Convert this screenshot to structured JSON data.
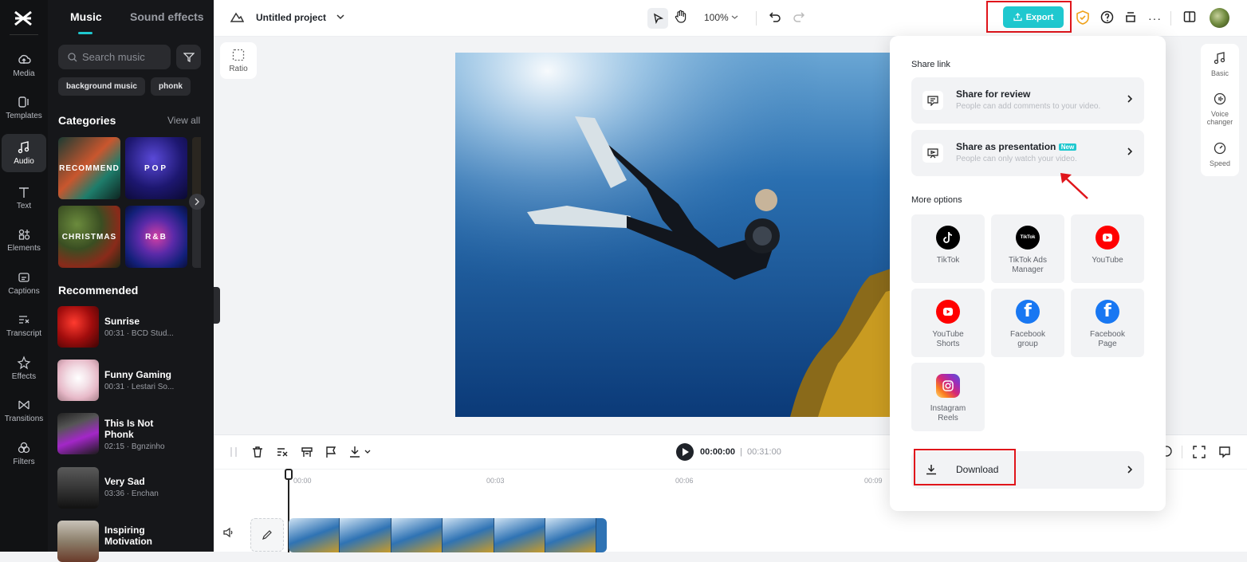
{
  "rail": {
    "items": [
      {
        "label": "Media",
        "icon": "cloud-icon"
      },
      {
        "label": "Templates",
        "icon": "templates-icon"
      },
      {
        "label": "Audio",
        "icon": "music-note-icon",
        "active": true
      },
      {
        "label": "Text",
        "icon": "text-icon"
      },
      {
        "label": "Elements",
        "icon": "elements-icon"
      },
      {
        "label": "Captions",
        "icon": "captions-icon"
      },
      {
        "label": "Transcript",
        "icon": "transcript-icon"
      },
      {
        "label": "Effects",
        "icon": "effects-icon"
      },
      {
        "label": "Transitions",
        "icon": "transitions-icon"
      },
      {
        "label": "Filters",
        "icon": "filters-icon"
      }
    ]
  },
  "panel": {
    "tabs": [
      "Music",
      "Sound effects"
    ],
    "search_placeholder": "Search music",
    "chips": [
      "background music",
      "phonk"
    ],
    "categories_title": "Categories",
    "view_all": "View all",
    "categories": [
      "RECOMMEND",
      "POP",
      "CHRISTMAS",
      "R&B"
    ],
    "recommended_title": "Recommended",
    "tracks": [
      {
        "name": "Sunrise",
        "meta": "00:31 · BCD Stud..."
      },
      {
        "name": "Funny Gaming",
        "meta": "00:31 · Lestari So..."
      },
      {
        "name": "This Is Not Phonk",
        "meta": "02:15 · Bgnzinho"
      },
      {
        "name": "Very Sad",
        "meta": "03:36 · Enchan"
      },
      {
        "name": "Inspiring Motivation",
        "meta": ""
      }
    ]
  },
  "topbar": {
    "project_name": "Untitled project",
    "zoom": "100%",
    "export_label": "Export"
  },
  "canvas": {
    "ratio_label": "Ratio"
  },
  "sidetools": [
    "Basic",
    "Voice changer",
    "Speed"
  ],
  "timeline": {
    "current_time": "00:00:00",
    "separator": "|",
    "total_time": "00:31:00",
    "ticks": [
      "00:00",
      "00:03",
      "00:06",
      "00:09"
    ]
  },
  "export_menu": {
    "share_link_title": "Share link",
    "share_review": {
      "title": "Share for review",
      "subtitle": "People can add comments to your video."
    },
    "share_presentation": {
      "title": "Share as presentation",
      "badge": "New",
      "subtitle": "People can only watch your video."
    },
    "more_options_title": "More options",
    "options": [
      {
        "label": "TikTok",
        "icon": "tiktok-icon",
        "color": "#000000"
      },
      {
        "label": "TikTok Ads Manager",
        "icon": "tiktok-ads-icon",
        "color": "#000000"
      },
      {
        "label": "YouTube",
        "icon": "youtube-icon",
        "color": "#ff0000"
      },
      {
        "label": "YouTube Shorts",
        "icon": "youtube-shorts-icon",
        "color": "#ff0000"
      },
      {
        "label": "Facebook group",
        "icon": "facebook-icon",
        "color": "#1877f2"
      },
      {
        "label": "Facebook Page",
        "icon": "facebook-icon",
        "color": "#1877f2"
      },
      {
        "label": "Instagram Reels",
        "icon": "instagram-icon",
        "color": "#e1306c"
      }
    ],
    "download_label": "Download"
  },
  "colors": {
    "accent": "#1fc8cf",
    "highlight": "#e0151b",
    "panel_bg": "#16171a"
  }
}
